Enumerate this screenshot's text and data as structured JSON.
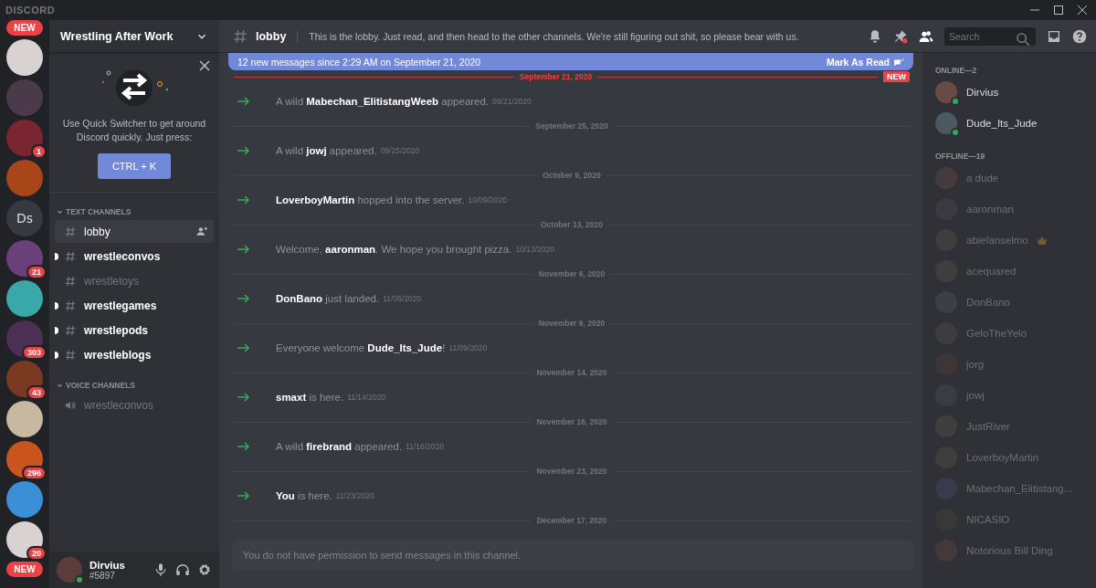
{
  "app_title": "DISCORD",
  "servers": [
    {
      "kind": "pill",
      "label": "NEW"
    },
    {
      "kind": "avatar"
    },
    {
      "kind": "avatar"
    },
    {
      "kind": "avatar",
      "badge": "1"
    },
    {
      "kind": "avatar"
    },
    {
      "kind": "initials",
      "label": "Ds"
    },
    {
      "kind": "avatar",
      "badge": "21"
    },
    {
      "kind": "avatar"
    },
    {
      "kind": "avatar",
      "badge": "303"
    },
    {
      "kind": "avatar",
      "badge": "43"
    },
    {
      "kind": "avatar"
    },
    {
      "kind": "avatar",
      "badge": "296"
    },
    {
      "kind": "avatar"
    },
    {
      "kind": "avatar",
      "badge": "20"
    },
    {
      "kind": "pill",
      "label": "NEW"
    }
  ],
  "server_name": "Wrestling After Work",
  "quick_switcher": {
    "text": "Use Quick Switcher to get around Discord quickly. Just press:",
    "shortcut": "CTRL + K"
  },
  "channel_groups": [
    {
      "title": "TEXT CHANNELS",
      "channels": [
        {
          "kind": "text",
          "name": "lobby",
          "selected": true,
          "unread": false
        },
        {
          "kind": "text",
          "name": "wrestleconvos",
          "selected": false,
          "unread": true
        },
        {
          "kind": "text",
          "name": "wrestletoys",
          "selected": false,
          "unread": false
        },
        {
          "kind": "text",
          "name": "wrestlegames",
          "selected": false,
          "unread": true
        },
        {
          "kind": "text",
          "name": "wrestlepods",
          "selected": false,
          "unread": true
        },
        {
          "kind": "text",
          "name": "wrestleblogs",
          "selected": false,
          "unread": true
        }
      ]
    },
    {
      "title": "VOICE CHANNELS",
      "channels": [
        {
          "kind": "voice",
          "name": "wrestleconvos",
          "selected": false,
          "unread": false
        }
      ]
    }
  ],
  "user": {
    "name": "Dirvius",
    "tag": "#5897"
  },
  "channel": {
    "name": "lobby",
    "topic": "This is the lobby. Just read, and then head to the other channels. We're still figuring out shit, so please bear with us."
  },
  "search": {
    "placeholder": "Search"
  },
  "new_messages_bar": {
    "text": "12 new messages since 2:29 AM on September 21, 2020",
    "action": "Mark As Read"
  },
  "timeline": [
    {
      "kind": "new-divider",
      "date": "September 21, 2020",
      "badge": "NEW"
    },
    {
      "kind": "join",
      "text": "A wild **Mabechan_ElitistangWeeb** appeared.",
      "time": "09/21/2020"
    },
    {
      "kind": "divider",
      "date": "September 25, 2020"
    },
    {
      "kind": "join",
      "text": "A wild **jowj** appeared.",
      "time": "09/25/2020"
    },
    {
      "kind": "divider",
      "date": "October 9, 2020"
    },
    {
      "kind": "join",
      "text": "**LoverboyMartin** hopped into the server.",
      "time": "10/09/2020"
    },
    {
      "kind": "divider",
      "date": "October 13, 2020"
    },
    {
      "kind": "join",
      "text": "Welcome, **aaronman**. We hope you brought pizza.",
      "time": "10/13/2020"
    },
    {
      "kind": "divider",
      "date": "November 6, 2020"
    },
    {
      "kind": "join",
      "text": "**DonBano** just landed.",
      "time": "11/06/2020"
    },
    {
      "kind": "divider",
      "date": "November 9, 2020"
    },
    {
      "kind": "join",
      "text": "Everyone welcome **Dude_Its_Jude**!",
      "time": "11/09/2020"
    },
    {
      "kind": "divider",
      "date": "November 14, 2020"
    },
    {
      "kind": "join",
      "text": "**smaxt** is here.",
      "time": "11/14/2020"
    },
    {
      "kind": "divider",
      "date": "November 16, 2020"
    },
    {
      "kind": "join",
      "text": "A wild **firebrand** appeared.",
      "time": "11/16/2020"
    },
    {
      "kind": "divider",
      "date": "November 23, 2020"
    },
    {
      "kind": "join",
      "text": "**You** is here.",
      "time": "11/23/2020"
    },
    {
      "kind": "divider",
      "date": "December 17, 2020"
    }
  ],
  "composer": {
    "placeholder": "You do not have permission to send messages in this channel."
  },
  "member_groups": [
    {
      "title": "ONLINE—2",
      "members": [
        {
          "name": "Dirvius",
          "online": true,
          "owner": false
        },
        {
          "name": "Dude_Its_Jude",
          "online": true,
          "owner": false
        }
      ]
    },
    {
      "title": "OFFLINE—19",
      "members": [
        {
          "name": "a dude",
          "online": false,
          "owner": false
        },
        {
          "name": "aaronman",
          "online": false,
          "owner": false
        },
        {
          "name": "abielanselmo",
          "online": false,
          "owner": true
        },
        {
          "name": "acequared",
          "online": false,
          "owner": false
        },
        {
          "name": "DonBano",
          "online": false,
          "owner": false
        },
        {
          "name": "GeloTheYelo",
          "online": false,
          "owner": false
        },
        {
          "name": "jorg",
          "online": false,
          "owner": false
        },
        {
          "name": "jowj",
          "online": false,
          "owner": false
        },
        {
          "name": "JustRiver",
          "online": false,
          "owner": false
        },
        {
          "name": "LoverboyMartin",
          "online": false,
          "owner": false
        },
        {
          "name": "Mabechan_Elitistang...",
          "online": false,
          "owner": false
        },
        {
          "name": "NICASIO",
          "online": false,
          "owner": false
        },
        {
          "name": "Notorious Bill Ding",
          "online": false,
          "owner": false
        }
      ]
    }
  ]
}
